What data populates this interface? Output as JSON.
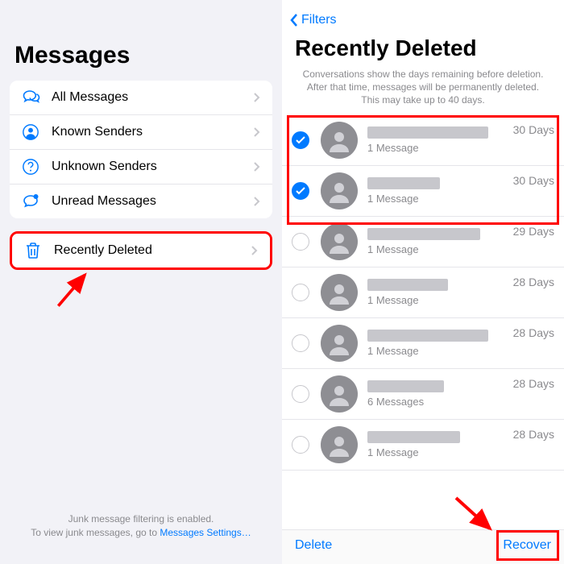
{
  "left": {
    "title": "Messages",
    "group1": [
      {
        "icon": "messages-icon",
        "label": "All Messages"
      },
      {
        "icon": "known-icon",
        "label": "Known Senders"
      },
      {
        "icon": "unknown-icon",
        "label": "Unknown Senders"
      },
      {
        "icon": "unread-icon",
        "label": "Unread Messages"
      }
    ],
    "group2": [
      {
        "icon": "trash-icon",
        "label": "Recently Deleted"
      }
    ],
    "footer_line1": "Junk message filtering is enabled.",
    "footer_line2a": "To view junk messages, go to ",
    "footer_link": "Messages Settings…"
  },
  "right": {
    "back_label": "Filters",
    "title": "Recently Deleted",
    "explain": "Conversations show the days remaining before deletion. After that time, messages will be permanently deleted. This may take up to 40 days.",
    "conversations": [
      {
        "selected": true,
        "name_w": 150,
        "count": "1 Message",
        "days": "30 Days"
      },
      {
        "selected": true,
        "name_w": 90,
        "count": "1 Message",
        "days": "30 Days"
      },
      {
        "selected": false,
        "name_w": 140,
        "count": "1 Message",
        "days": "29 Days"
      },
      {
        "selected": false,
        "name_w": 100,
        "count": "1 Message",
        "days": "28 Days"
      },
      {
        "selected": false,
        "name_w": 150,
        "count": "1 Message",
        "days": "28 Days"
      },
      {
        "selected": false,
        "name_w": 95,
        "count": "6 Messages",
        "days": "28 Days"
      },
      {
        "selected": false,
        "name_w": 115,
        "count": "1 Message",
        "days": "28 Days"
      }
    ],
    "toolbar": {
      "delete": "Delete",
      "recover": "Recover"
    }
  },
  "colors": {
    "accent": "#007aff",
    "annot": "#ff0000"
  }
}
